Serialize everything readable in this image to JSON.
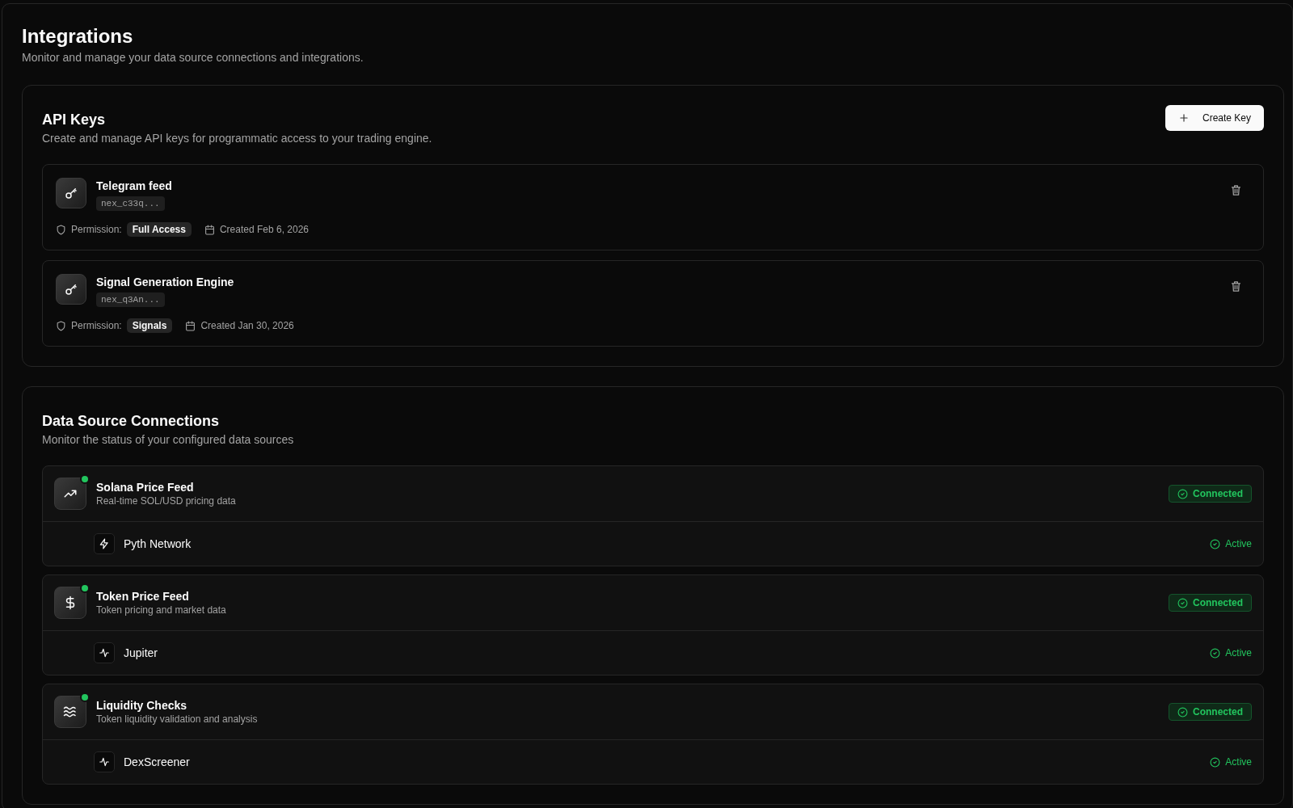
{
  "page": {
    "title": "Integrations",
    "subtitle": "Monitor and manage your data source connections and integrations."
  },
  "api_keys": {
    "title": "API Keys",
    "subtitle": "Create and manage API keys for programmatic access to your trading engine.",
    "create_button": "Create Key",
    "keys": [
      {
        "name": "Telegram feed",
        "key": "nex_c33q...",
        "permission_label": "Permission:",
        "permission": "Full Access",
        "created": "Created Feb 6, 2026"
      },
      {
        "name": "Signal Generation Engine",
        "key": "nex_q3An...",
        "permission_label": "Permission:",
        "permission": "Signals",
        "created": "Created Jan 30, 2026"
      }
    ]
  },
  "data_sources": {
    "title": "Data Source Connections",
    "subtitle": "Monitor the status of your configured data sources",
    "sources": [
      {
        "online": true,
        "name": "Solana Price Feed",
        "description": "Real-time SOL/USD pricing data",
        "status": "Connected",
        "provider": {
          "name": "Pyth Network",
          "status": "Active"
        }
      },
      {
        "online": true,
        "name": "Token Price Feed",
        "description": "Token pricing and market data",
        "status": "Connected",
        "provider": {
          "name": "Jupiter",
          "status": "Active"
        }
      },
      {
        "online": true,
        "name": "Liquidity Checks",
        "description": "Token liquidity validation and analysis",
        "status": "Connected",
        "provider": {
          "name": "DexScreener",
          "status": "Active"
        }
      }
    ]
  }
}
